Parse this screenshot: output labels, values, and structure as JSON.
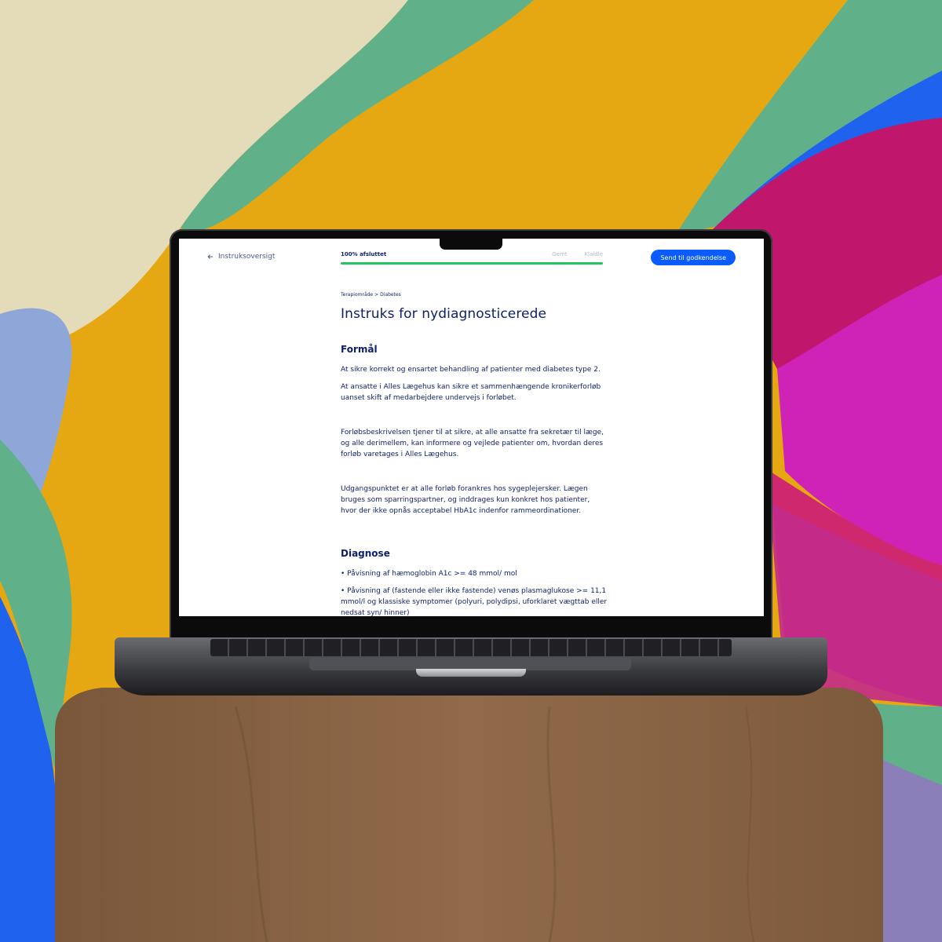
{
  "header": {
    "back_label": "Instruksoversigt",
    "progress_label": "100% afsluttet",
    "progress_value": 1.0,
    "status_saved": "Gemt",
    "status_ready": "Klaldle",
    "send_button_label": "Send til godkendelse"
  },
  "breadcrumb": {
    "area": "Terapiområde",
    "separator": ">",
    "topic": "Diabetes"
  },
  "page_title": "Instruks for nydiagnosticerede",
  "sections": [
    {
      "heading": "Formål",
      "paragraphs": [
        "At sikre korrekt og ensartet behandling af patienter med diabetes type 2.",
        "At ansatte i Alles Lægehus kan sikre et sammenhængende kronikerforløb uanset skift af medarbejdere undervejs i forløbet.",
        "Forløbsbeskrivelsen tjener til at sikre, at alle ansatte fra sekretær til læge, og alle derimellem, kan informere og vejlede patienter om, hvordan deres forløb varetages i Alles Lægehus.",
        "Udgangspunktet er at alle forløb forankres hos sygeplejersker. Lægen bruges som sparringspartner, og inddrages kun konkret hos patienter, hvor der ikke opnås acceptabel HbA1c indenfor rammeordinationer."
      ]
    },
    {
      "heading": "Diagnose",
      "bullets": [
        "• Påvisning af hæmoglobin A1c >= 48 mmol/ mol",
        "• Påvisning af (fastende eller ikke fastende) venøs plasmaglukose >= 11,1 mmol/l og klassiske symptomer (polyuri, polydipsi, uforklaret vægttab eller nedsat syn/ hinner)"
      ]
    }
  ],
  "colors": {
    "accent": "#0a5cff",
    "progress": "#22c55e",
    "text": "#0b1e6b"
  }
}
